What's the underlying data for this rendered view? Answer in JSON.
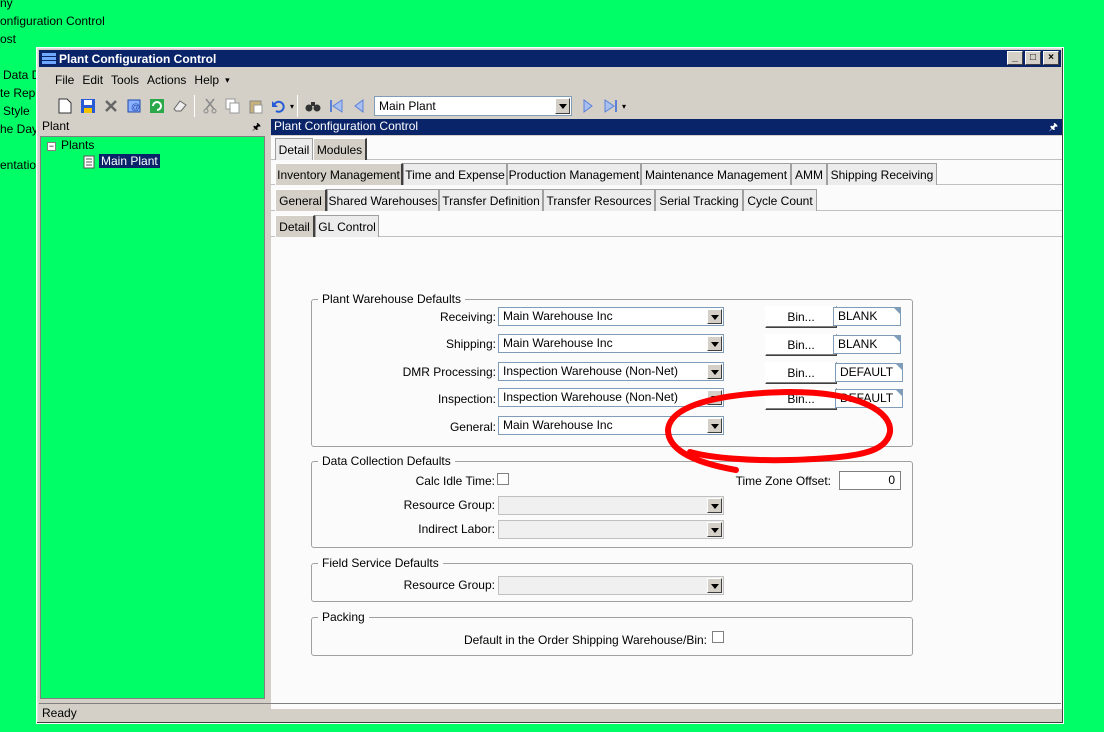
{
  "background_texts": [
    "ny",
    "onfiguration Control",
    "ost",
    "Data D",
    "te Repo",
    "Style",
    "he Day",
    "entation"
  ],
  "window": {
    "title": "Plant Configuration Control",
    "controls": {
      "minimize": "_",
      "maximize": "□",
      "close": "×"
    }
  },
  "menu": [
    "File",
    "Edit",
    "Tools",
    "Actions",
    "Help"
  ],
  "toolbar": {
    "plant_selector_value": "Main Plant"
  },
  "left_panel": {
    "title": "Plant",
    "tree": {
      "root": "Plants",
      "child": "Main Plant"
    }
  },
  "right_panel": {
    "title": "Plant Configuration Control",
    "tabs_level1": [
      "Detail",
      "Modules"
    ],
    "tabs_level2": [
      "Inventory Management",
      "Time and Expense",
      "Production Management",
      "Maintenance Management",
      "AMM",
      "Shipping Receiving"
    ],
    "tabs_level3": [
      "General",
      "Shared Warehouses",
      "Transfer Definition",
      "Transfer Resources",
      "Serial Tracking",
      "Cycle Count"
    ],
    "tabs_level4": [
      "Detail",
      "GL Control"
    ]
  },
  "warehouse_defaults": {
    "legend": "Plant Warehouse Defaults",
    "bin_button_label": "Bin...",
    "rows": [
      {
        "label": "Receiving:",
        "value": "Main Warehouse Inc",
        "bin": "BLANK"
      },
      {
        "label": "Shipping:",
        "value": "Main Warehouse Inc",
        "bin": "BLANK"
      },
      {
        "label": "DMR Processing:",
        "value": "Inspection Warehouse (Non-Net)",
        "bin": "DEFAULT"
      },
      {
        "label": "Inspection:",
        "value": "Inspection Warehouse (Non-Net)",
        "bin": "DEFAULT"
      },
      {
        "label": "General:",
        "value": "Main Warehouse Inc",
        "bin": ""
      }
    ]
  },
  "data_collection": {
    "legend": "Data Collection Defaults",
    "calc_idle_label": "Calc Idle Time:",
    "time_zone_label": "Time Zone Offset:",
    "time_zone_value": "0",
    "resource_group_label": "Resource Group:",
    "indirect_labor_label": "Indirect Labor:"
  },
  "field_service": {
    "legend": "Field Service Defaults",
    "resource_group_label": "Resource Group:"
  },
  "packing": {
    "legend": "Packing",
    "default_label": "Default in the Order Shipping Warehouse/Bin:"
  },
  "status": {
    "text": "Ready"
  },
  "colors": {
    "desktop": "#00ff66",
    "titlebar": "#0a246a",
    "annotation": "#ff0000"
  }
}
